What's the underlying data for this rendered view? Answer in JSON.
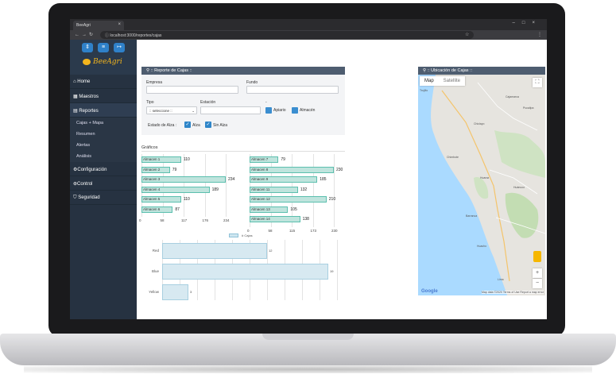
{
  "browser": {
    "tab_title": "BeeAgri",
    "url": "localhost:3000/reportes/cajas"
  },
  "sidebar": {
    "logo_text": "BeeAgri",
    "top_icons": [
      "download-icon",
      "menu-icon",
      "logout-icon"
    ],
    "items": [
      {
        "label": "Home",
        "icon": "home-icon"
      },
      {
        "label": "Maestros",
        "icon": "table-icon"
      },
      {
        "label": "Reportes",
        "icon": "calendar-icon"
      },
      {
        "label": "Configuración",
        "icon": "cogs-icon"
      },
      {
        "label": "Control",
        "icon": "control-icon"
      },
      {
        "label": "Seguridad",
        "icon": "shield-icon"
      }
    ],
    "subitems": [
      "Cajas + Mapa",
      "Resumen",
      "Alertas",
      "Análisis"
    ]
  },
  "report": {
    "title": ":: Reporte de Cajas ::",
    "empresa_label": "Empresa",
    "empresa_value": "",
    "fundo_label": "Fundo",
    "fundo_value": "",
    "tipo_label": "Tipo",
    "tipo_value": ":: seleccione ::",
    "estacion_label": "Estación",
    "estacion_value": "",
    "dash": "-",
    "apiario_label": "Apiario",
    "almacen_label": "Almacén",
    "estado_label": "Estado de Alza :",
    "alza_label": "Alza",
    "sin_alza_label": "Sin Alza",
    "graficos_label": "Gráficos"
  },
  "map": {
    "title": ":: Ubicación de Cajas ::",
    "tab_map": "Map",
    "tab_satellite": "Satellite",
    "google": "Google",
    "attribution": "Map data ©2020   Terms of Use   Report a map error",
    "labels": [
      "Trujillo",
      "Cajamarca",
      "Chiclayo",
      "Chimbote",
      "Huaraz",
      "Huánuco",
      "Barranca",
      "Huacho",
      "Lima",
      "Pucallpa"
    ]
  },
  "chart_data": [
    {
      "type": "bar",
      "orientation": "horizontal",
      "categories": [
        "Almacen 1",
        "Almacen 2",
        "Almacen 3",
        "Almacen 4",
        "Almacen 5",
        "Almacen 6"
      ],
      "values": [
        110,
        79,
        234,
        189,
        110,
        87
      ],
      "xlim": [
        0,
        234
      ],
      "ticks": [
        "0",
        "58",
        "117",
        "176",
        "234"
      ]
    },
    {
      "type": "bar",
      "orientation": "horizontal",
      "categories": [
        "Almacen 7",
        "Almacen 8",
        "Almacen 9",
        "Almacen 11",
        "Almacen 12",
        "Almacen 13",
        "Almacen 14"
      ],
      "values": [
        79,
        230,
        185,
        132,
        210,
        105,
        138
      ],
      "xlim": [
        0,
        230
      ],
      "ticks": [
        "0",
        "58",
        "115",
        "173",
        "230"
      ]
    },
    {
      "type": "bar",
      "orientation": "horizontal",
      "legend": "# Cajas",
      "categories": [
        "Red",
        "Blue",
        "Yellow"
      ],
      "values": [
        12,
        19,
        3
      ],
      "xlim": [
        0,
        20
      ]
    }
  ]
}
